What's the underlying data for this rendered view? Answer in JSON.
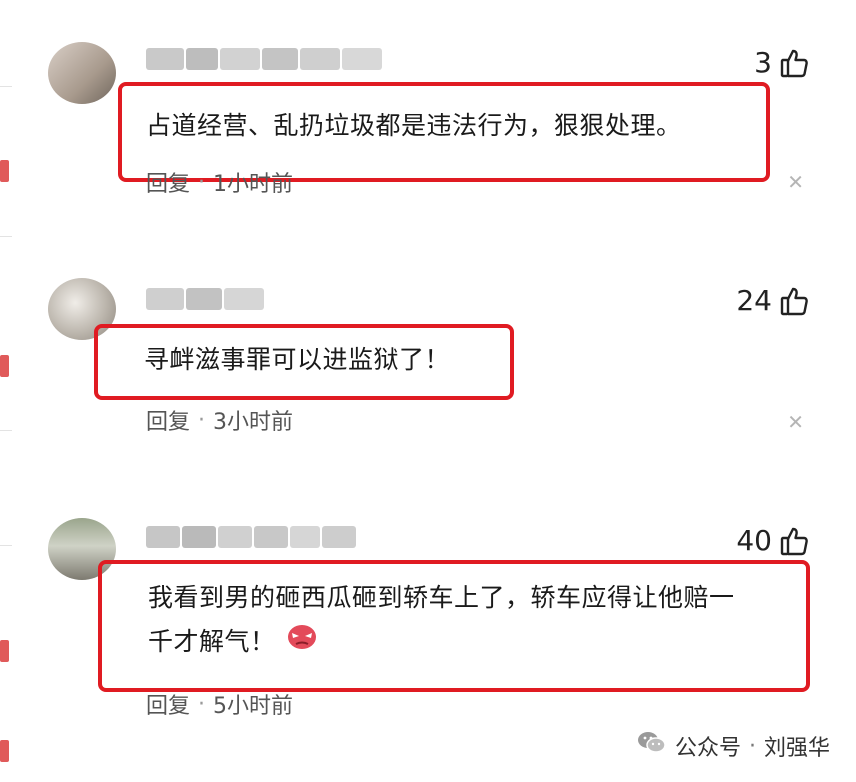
{
  "comments": [
    {
      "likes": "3",
      "text": "占道经营、乱扔垃圾都是违法行为，狠狠处理。",
      "reply_label": "回复",
      "time": "1小时前"
    },
    {
      "likes": "24",
      "text": "寻衅滋事罪可以进监狱了！",
      "reply_label": "回复",
      "time": "3小时前"
    },
    {
      "likes": "40",
      "text_line1": "我看到男的砸西瓜砸到轿车上了，轿车应得让他赔一",
      "text_line2": "千才解气！",
      "reply_label": "回复",
      "time": "5小时前",
      "emoji": "angry-face-icon"
    }
  ],
  "watermark": {
    "icon": "wechat-icon",
    "source": "公众号",
    "separator": "·",
    "author": "刘强华"
  },
  "colors": {
    "highlight_border": "#e01b22",
    "text": "#1a1a1a",
    "meta": "#555555",
    "close": "#b5b5b5"
  }
}
